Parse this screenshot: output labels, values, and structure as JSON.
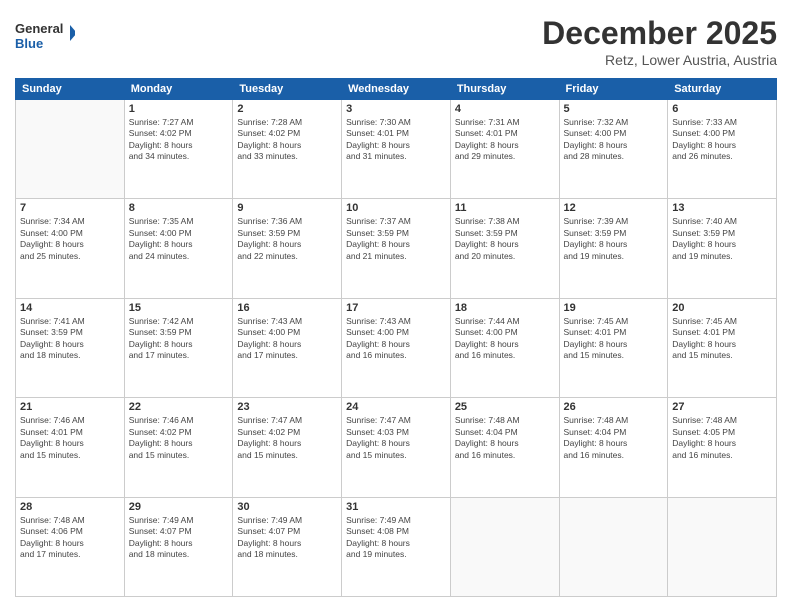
{
  "header": {
    "logo_line1": "General",
    "logo_line2": "Blue",
    "month": "December 2025",
    "location": "Retz, Lower Austria, Austria"
  },
  "weekdays": [
    "Sunday",
    "Monday",
    "Tuesday",
    "Wednesday",
    "Thursday",
    "Friday",
    "Saturday"
  ],
  "weeks": [
    [
      {
        "day": "",
        "text": ""
      },
      {
        "day": "1",
        "text": "Sunrise: 7:27 AM\nSunset: 4:02 PM\nDaylight: 8 hours\nand 34 minutes."
      },
      {
        "day": "2",
        "text": "Sunrise: 7:28 AM\nSunset: 4:02 PM\nDaylight: 8 hours\nand 33 minutes."
      },
      {
        "day": "3",
        "text": "Sunrise: 7:30 AM\nSunset: 4:01 PM\nDaylight: 8 hours\nand 31 minutes."
      },
      {
        "day": "4",
        "text": "Sunrise: 7:31 AM\nSunset: 4:01 PM\nDaylight: 8 hours\nand 29 minutes."
      },
      {
        "day": "5",
        "text": "Sunrise: 7:32 AM\nSunset: 4:00 PM\nDaylight: 8 hours\nand 28 minutes."
      },
      {
        "day": "6",
        "text": "Sunrise: 7:33 AM\nSunset: 4:00 PM\nDaylight: 8 hours\nand 26 minutes."
      }
    ],
    [
      {
        "day": "7",
        "text": "Sunrise: 7:34 AM\nSunset: 4:00 PM\nDaylight: 8 hours\nand 25 minutes."
      },
      {
        "day": "8",
        "text": "Sunrise: 7:35 AM\nSunset: 4:00 PM\nDaylight: 8 hours\nand 24 minutes."
      },
      {
        "day": "9",
        "text": "Sunrise: 7:36 AM\nSunset: 3:59 PM\nDaylight: 8 hours\nand 22 minutes."
      },
      {
        "day": "10",
        "text": "Sunrise: 7:37 AM\nSunset: 3:59 PM\nDaylight: 8 hours\nand 21 minutes."
      },
      {
        "day": "11",
        "text": "Sunrise: 7:38 AM\nSunset: 3:59 PM\nDaylight: 8 hours\nand 20 minutes."
      },
      {
        "day": "12",
        "text": "Sunrise: 7:39 AM\nSunset: 3:59 PM\nDaylight: 8 hours\nand 19 minutes."
      },
      {
        "day": "13",
        "text": "Sunrise: 7:40 AM\nSunset: 3:59 PM\nDaylight: 8 hours\nand 19 minutes."
      }
    ],
    [
      {
        "day": "14",
        "text": "Sunrise: 7:41 AM\nSunset: 3:59 PM\nDaylight: 8 hours\nand 18 minutes."
      },
      {
        "day": "15",
        "text": "Sunrise: 7:42 AM\nSunset: 3:59 PM\nDaylight: 8 hours\nand 17 minutes."
      },
      {
        "day": "16",
        "text": "Sunrise: 7:43 AM\nSunset: 4:00 PM\nDaylight: 8 hours\nand 17 minutes."
      },
      {
        "day": "17",
        "text": "Sunrise: 7:43 AM\nSunset: 4:00 PM\nDaylight: 8 hours\nand 16 minutes."
      },
      {
        "day": "18",
        "text": "Sunrise: 7:44 AM\nSunset: 4:00 PM\nDaylight: 8 hours\nand 16 minutes."
      },
      {
        "day": "19",
        "text": "Sunrise: 7:45 AM\nSunset: 4:01 PM\nDaylight: 8 hours\nand 15 minutes."
      },
      {
        "day": "20",
        "text": "Sunrise: 7:45 AM\nSunset: 4:01 PM\nDaylight: 8 hours\nand 15 minutes."
      }
    ],
    [
      {
        "day": "21",
        "text": "Sunrise: 7:46 AM\nSunset: 4:01 PM\nDaylight: 8 hours\nand 15 minutes."
      },
      {
        "day": "22",
        "text": "Sunrise: 7:46 AM\nSunset: 4:02 PM\nDaylight: 8 hours\nand 15 minutes."
      },
      {
        "day": "23",
        "text": "Sunrise: 7:47 AM\nSunset: 4:02 PM\nDaylight: 8 hours\nand 15 minutes."
      },
      {
        "day": "24",
        "text": "Sunrise: 7:47 AM\nSunset: 4:03 PM\nDaylight: 8 hours\nand 15 minutes."
      },
      {
        "day": "25",
        "text": "Sunrise: 7:48 AM\nSunset: 4:04 PM\nDaylight: 8 hours\nand 16 minutes."
      },
      {
        "day": "26",
        "text": "Sunrise: 7:48 AM\nSunset: 4:04 PM\nDaylight: 8 hours\nand 16 minutes."
      },
      {
        "day": "27",
        "text": "Sunrise: 7:48 AM\nSunset: 4:05 PM\nDaylight: 8 hours\nand 16 minutes."
      }
    ],
    [
      {
        "day": "28",
        "text": "Sunrise: 7:48 AM\nSunset: 4:06 PM\nDaylight: 8 hours\nand 17 minutes."
      },
      {
        "day": "29",
        "text": "Sunrise: 7:49 AM\nSunset: 4:07 PM\nDaylight: 8 hours\nand 18 minutes."
      },
      {
        "day": "30",
        "text": "Sunrise: 7:49 AM\nSunset: 4:07 PM\nDaylight: 8 hours\nand 18 minutes."
      },
      {
        "day": "31",
        "text": "Sunrise: 7:49 AM\nSunset: 4:08 PM\nDaylight: 8 hours\nand 19 minutes."
      },
      {
        "day": "",
        "text": ""
      },
      {
        "day": "",
        "text": ""
      },
      {
        "day": "",
        "text": ""
      }
    ]
  ]
}
